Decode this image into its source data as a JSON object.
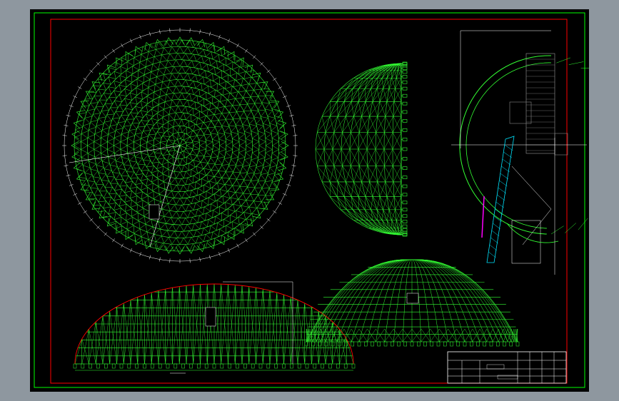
{
  "colors": {
    "app_background": "#8e979f",
    "paper": "#000000",
    "frame_outer": "#00ff00",
    "frame_inner": "#ff0000",
    "structure": "#33ff33",
    "dimension_lines": "#ffffff",
    "support_members": "#00e5ff",
    "highlight_member": "#ff00ff"
  },
  "views": {
    "plan_view": "plan-view",
    "side_quarter_view": "side-quarter-view",
    "section_view": "section-view",
    "elevation_view": "elevation-view",
    "perspective_view": "perspective-view"
  },
  "title_block": {
    "left_labels": [
      "",
      "",
      ""
    ],
    "right_labels": [
      "",
      "",
      ""
    ]
  }
}
